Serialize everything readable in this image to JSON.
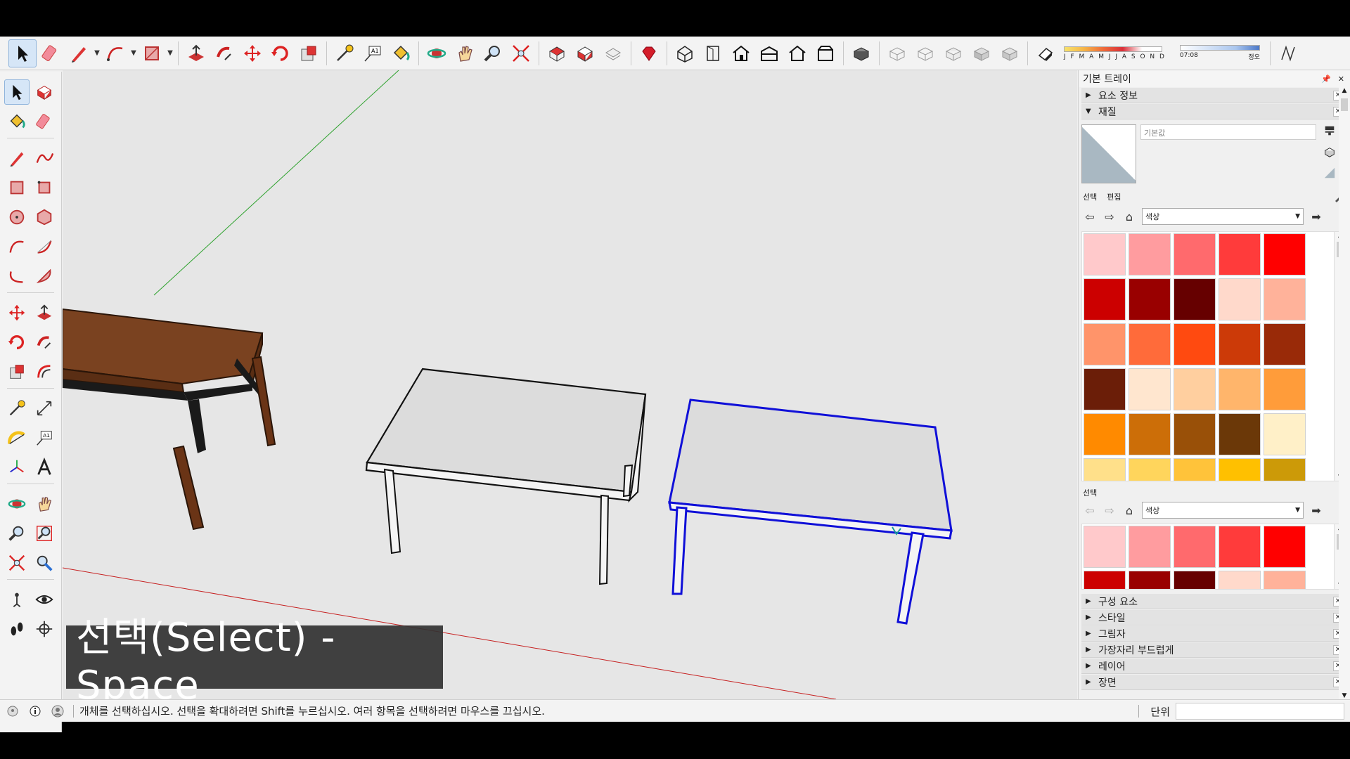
{
  "toolbar": {
    "tools": [
      "select-icon",
      "eraser-icon",
      "pencil-icon",
      "freehand-icon",
      "rectangle-icon",
      "pushpull-icon",
      "follow-me-icon",
      "move-icon",
      "rotate-icon",
      "scale-icon",
      "tape-measure-icon",
      "text-icon",
      "paint-bucket-icon",
      "orbit-icon",
      "pan-icon",
      "zoom-icon",
      "zoom-extents-icon",
      "component-icon",
      "group-icon",
      "outliner-icon",
      "ruby-icon",
      "iso-view-icon",
      "front-view-icon",
      "home-view-icon",
      "top-view-icon",
      "right-view-icon",
      "back-view-icon",
      "section-icon",
      "style-xray-icon",
      "style-wire-icon",
      "style-hidden-icon",
      "style-shaded-icon",
      "style-textured-icon",
      "shadow-toggle-icon"
    ],
    "months_label": "J F M A M J J A S O N D",
    "time_start": "07:08",
    "time_noon": "정오"
  },
  "tray": {
    "title": "기본 트레이",
    "panel_entity_info": "요소 정보",
    "panel_materials": "재질",
    "material_name": "기본값",
    "tab_select": "선택",
    "tab_edit": "편집",
    "library": "색상",
    "secondary_label": "선택",
    "secondary_library": "색상",
    "panels_collapsed": [
      "구성 요소",
      "스타일",
      "그림자",
      "가장자리 부드럽게",
      "레이어",
      "장면"
    ]
  },
  "palette_colors": [
    "#ffc9cb",
    "#ff9c9f",
    "#ff6a6d",
    "#ff3b3b",
    "#ff0000",
    "#cc0000",
    "#990000",
    "#660000",
    "#ffd9cb",
    "#ffb29a",
    "#ff946a",
    "#ff6b3a",
    "#ff4a10",
    "#cc3a08",
    "#992a08",
    "#6b1e08",
    "#ffe6cf",
    "#ffcf9f",
    "#ffb56b",
    "#ff9c3a",
    "#ff8a00",
    "#cc6e08",
    "#995008",
    "#6b3808",
    "#fff0c8",
    "#ffe08a",
    "#ffd55c",
    "#ffc33a",
    "#ffc000",
    "#cc9a08"
  ],
  "palette2_colors": [
    "#ffc9cb",
    "#ff9c9f",
    "#ff6a6d",
    "#ff3b3b",
    "#ff0000",
    "#cc0000",
    "#990000",
    "#660000",
    "#ffd9cb",
    "#ffb29a"
  ],
  "caption": "선택(Select) - Space",
  "status": {
    "message": "개체를 선택하십시오. 선택을 확대하려면 Shift를 누르십시오. 여러 항목을 선택하려면 마우스를 끄십시오.",
    "unit_label": "단위"
  },
  "colors": {
    "selection": "#1010d8",
    "wood": "#7a4220",
    "background": "#e6e6e6"
  }
}
